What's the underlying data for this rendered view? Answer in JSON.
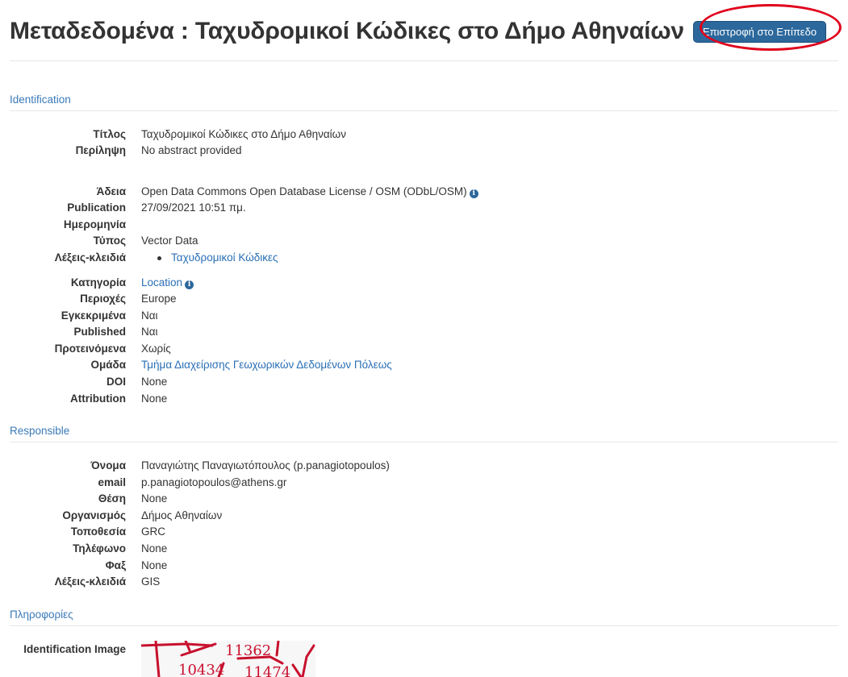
{
  "page": {
    "title": "Μεταδεδομένα : Ταχυδρομικοί Κώδικες στο Δήμο Αθηναίων",
    "back_button": "Επιστροφή στο Επίπεδο"
  },
  "sections": {
    "identification": "Identification",
    "responsible": "Responsible",
    "info": "Πληροφορίες"
  },
  "identification": {
    "title_label": "Τίτλος",
    "title_value": "Ταχυδρομικοί Κώδικες στο Δήμο Αθηναίων",
    "abstract_label": "Περίληψη",
    "abstract_value": "No abstract provided",
    "license_label": "Άδεια",
    "license_value": "Open Data Commons Open Database License / OSM (ODbL/OSM)",
    "publication_label_1": "Publication",
    "publication_label_2": "Ημερομηνία",
    "publication_value": "27/09/2021 10:51 πμ.",
    "type_label": "Τύπος",
    "type_value": "Vector Data",
    "keywords_label": "Λέξεις-κλειδιά",
    "keywords": [
      "Ταχυδρομικοί Κώδικες"
    ],
    "category_label": "Κατηγορία",
    "category_value": "Location",
    "regions_label": "Περιοχές",
    "regions_value": "Europe",
    "approved_label": "Εγκεκριμένα",
    "approved_value": "Ναι",
    "published_label": "Published",
    "published_value": "Ναι",
    "featured_label": "Προτεινόμενα",
    "featured_value": "Χωρίς",
    "group_label": "Ομάδα",
    "group_value": "Τμήμα Διαχείρισης Γεωχωρικών Δεδομένων Πόλεως",
    "doi_label": "DOI",
    "doi_value": "None",
    "attribution_label": "Attribution",
    "attribution_value": "None"
  },
  "responsible": {
    "name_label": "Όνομα",
    "name_value": "Παναγιώτης Παναγιωτόπουλος (p.panagiotopoulos)",
    "email_label": "email",
    "email_value": "p.panagiotopoulos@athens.gr",
    "position_label": "Θέση",
    "position_value": "None",
    "organization_label": "Οργανισμός",
    "organization_value": "Δήμος Αθηναίων",
    "location_label": "Τοποθεσία",
    "location_value": "GRC",
    "phone_label": "Τηλέφωνο",
    "phone_value": "None",
    "fax_label": "Φαξ",
    "fax_value": "None",
    "keywords_label": "Λέξεις-κλειδιά",
    "keywords_value": "GIS"
  },
  "info": {
    "image_label": "Identification Image",
    "image_labels": [
      "11362",
      "10434",
      "11474"
    ]
  },
  "colors": {
    "accent": "#2c689c",
    "link": "#2a6fb5",
    "section_heading": "#3a7ab8",
    "highlight": "#e0001b",
    "map_lines": "#c8102e"
  }
}
